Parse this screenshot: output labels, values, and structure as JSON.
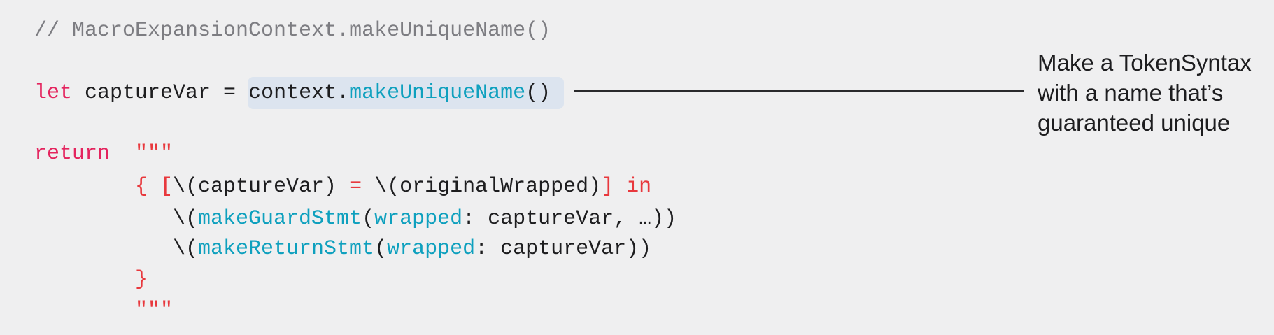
{
  "code": {
    "lines": [
      {
        "indent": 0,
        "tokens": [
          {
            "t": "// MacroExpansionContext.makeUniqueName()",
            "c": "comment"
          }
        ]
      },
      {
        "indent": 0,
        "tokens": [
          {
            "t": "let",
            "c": "keyword"
          },
          {
            "t": " captureVar = ",
            "c": "plain"
          },
          {
            "t": "context.",
            "c": "plain"
          },
          {
            "t": "makeUniqueName",
            "c": "func"
          },
          {
            "t": "()",
            "c": "plain"
          }
        ]
      },
      {
        "indent": 0,
        "tokens": [
          {
            "t": "return",
            "c": "keyword"
          },
          {
            "t": "  ",
            "c": "plain"
          },
          {
            "t": "\"\"\"",
            "c": "string"
          }
        ]
      },
      {
        "indent": 8,
        "tokens": [
          {
            "t": "{ [",
            "c": "string"
          },
          {
            "t": "\\(captureVar)",
            "c": "plain"
          },
          {
            "t": " = ",
            "c": "string"
          },
          {
            "t": "\\(originalWrapped)",
            "c": "plain"
          },
          {
            "t": "] in",
            "c": "string"
          }
        ]
      },
      {
        "indent": 11,
        "tokens": [
          {
            "t": "\\(",
            "c": "plain"
          },
          {
            "t": "makeGuardStmt",
            "c": "func"
          },
          {
            "t": "(",
            "c": "plain"
          },
          {
            "t": "wrapped",
            "c": "func"
          },
          {
            "t": ": captureVar, …))",
            "c": "plain"
          }
        ]
      },
      {
        "indent": 11,
        "tokens": [
          {
            "t": "\\(",
            "c": "plain"
          },
          {
            "t": "makeReturnStmt",
            "c": "func"
          },
          {
            "t": "(",
            "c": "plain"
          },
          {
            "t": "wrapped",
            "c": "func"
          },
          {
            "t": ": captureVar))",
            "c": "plain"
          }
        ]
      },
      {
        "indent": 8,
        "tokens": [
          {
            "t": "}",
            "c": "string"
          }
        ]
      },
      {
        "indent": 8,
        "tokens": [
          {
            "t": "\"\"\"",
            "c": "string"
          }
        ]
      }
    ]
  },
  "annotation": {
    "lines": [
      "Make a TokenSyntax",
      "with a name that’s",
      "guaranteed unique"
    ]
  },
  "colors": {
    "background": "#efeff0",
    "keyword": "#e4245e",
    "string": "#e8383d",
    "function": "#0ea0be",
    "comment": "#7d7d82",
    "highlight": "#dce4ef"
  }
}
